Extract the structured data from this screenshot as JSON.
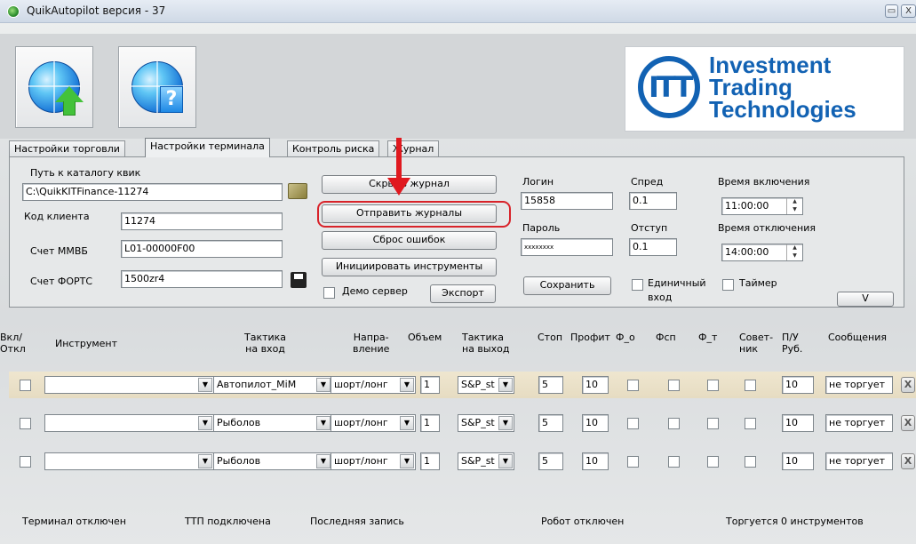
{
  "window": {
    "title": "QuikAutopilot версия - 37",
    "minimize": "▭",
    "close": "X"
  },
  "logo": {
    "mark": "ITT",
    "line1": "Investment",
    "line2": "Trading",
    "line3": "Technologies"
  },
  "tabs": [
    {
      "label": "Настройки торговли",
      "active": false
    },
    {
      "label": "Настройки терминала",
      "active": true
    },
    {
      "label": "Контроль риска",
      "active": false
    },
    {
      "label": "Журнал",
      "active": false
    }
  ],
  "settings": {
    "quik_path_label": "Путь к каталогу квик",
    "quik_path_value": "C:\\QuikKITFinance-11274",
    "client_code_label": "Код клиента",
    "client_code_value": "11274",
    "micex_label": "Счет ММВБ",
    "micex_value": "L01-00000F00",
    "forts_label": "Счет ФОРТС",
    "forts_value": "1500zr4",
    "btn_hide_log": "Скрыть журнал",
    "btn_send_logs": "Отправить журналы",
    "btn_reset_errors": "Сброс ошибок",
    "btn_init_instruments": "Инициировать инструменты",
    "demo_label": "Демо сервер",
    "btn_export": "Экспорт",
    "login_label": "Логин",
    "login_value": "15858",
    "password_label": "Пароль",
    "password_value": "xxxxxxxx",
    "btn_save": "Сохранить",
    "spread_label": "Спред",
    "spread_value": "0.1",
    "offset_label": "Отступ",
    "offset_value": "0.1",
    "single_entry_label": "Единичный",
    "single_entry_label2": "вход",
    "timer_label": "Таймер",
    "on_time_label": "Время включения",
    "on_time_value": "11:00:00",
    "off_time_label": "Время отключения",
    "off_time_value": "14:00:00",
    "expand_btn": "V"
  },
  "table": {
    "headers": {
      "onoff": [
        "Вкл/",
        "Откл"
      ],
      "instrument": "Инструмент",
      "entry_tactic": [
        "Тактика",
        "на вход"
      ],
      "direction": [
        "Напра-",
        "вление"
      ],
      "volume": "Объем",
      "exit_tactic": [
        "Тактика",
        "на выход"
      ],
      "stop": "Стоп",
      "profit": "Профит",
      "f_o": "Ф_о",
      "f_sp": "Фсп",
      "f_t": "Ф_т",
      "advisor": [
        "Совет-",
        "ник"
      ],
      "pnl": [
        "П/У",
        "Руб."
      ],
      "messages": "Сообщения"
    },
    "rows": [
      {
        "instrument": "",
        "entry": "Автопилот_МіМ",
        "direction": "шорт/лонг",
        "volume": "1",
        "exit": "S&P_st",
        "stop": "5",
        "profit": "10",
        "pnl": "10",
        "message": "не торгует",
        "highlight": true
      },
      {
        "instrument": "",
        "entry": "Рыболов",
        "direction": "шорт/лонг",
        "volume": "1",
        "exit": "S&P_st",
        "stop": "5",
        "profit": "10",
        "pnl": "10",
        "message": "не торгует",
        "highlight": false
      },
      {
        "instrument": "",
        "entry": "Рыболов",
        "direction": "шорт/лонг",
        "volume": "1",
        "exit": "S&P_st",
        "stop": "5",
        "profit": "10",
        "pnl": "10",
        "message": "не торгует",
        "highlight": false
      }
    ]
  },
  "statusbar": {
    "terminal": "Терминал отключен",
    "ttp": "ТТП подключена",
    "last_record": "Последняя запись",
    "robot": "Робот отключен",
    "trading": "Торгуется 0 инструментов"
  }
}
